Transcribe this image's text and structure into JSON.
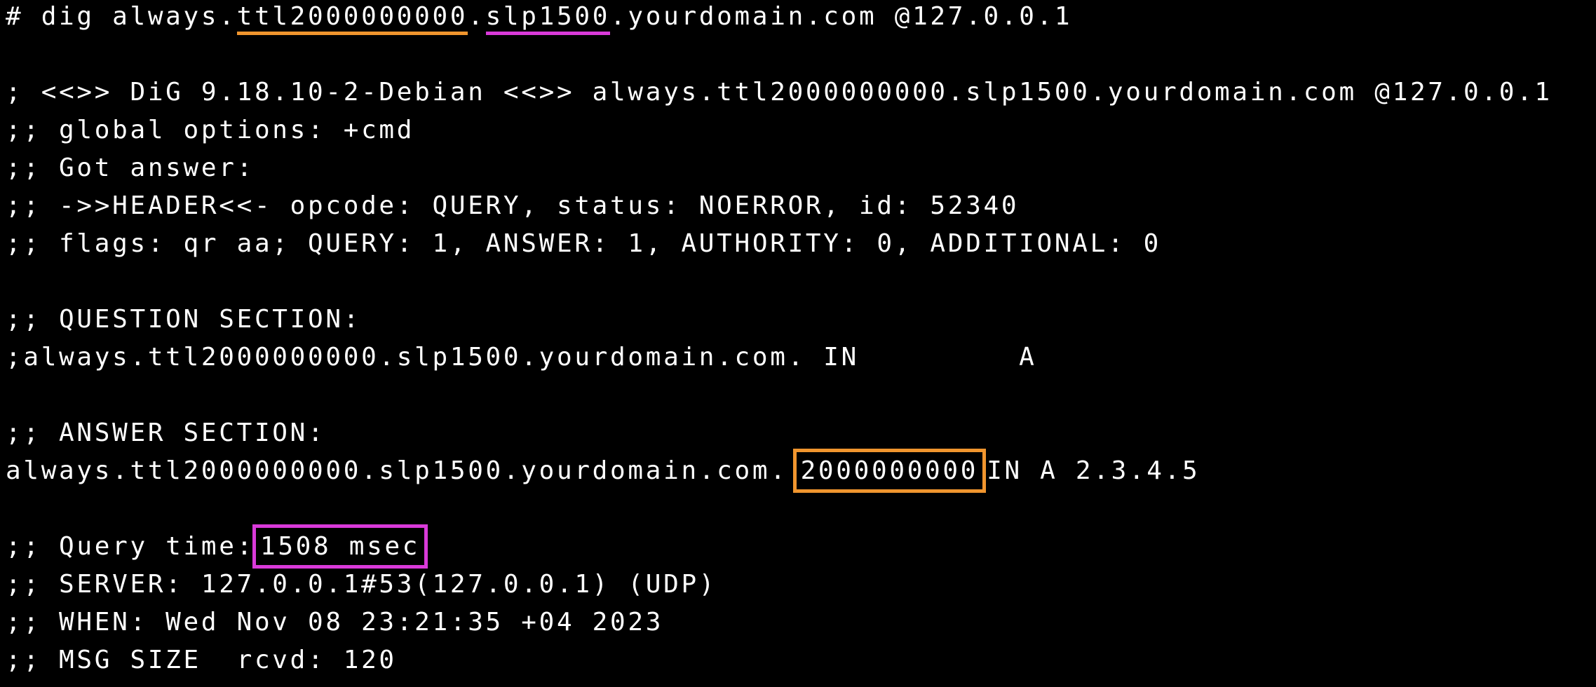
{
  "window": {
    "background": "#000000",
    "text_color": "#ffffff",
    "accent_orange": "#f0952e",
    "accent_magenta": "#d93ad9"
  },
  "command": {
    "prompt": "# dig always.",
    "ttl_label": "ttl2000000000",
    "dot": ".",
    "slp_label": "slp1500",
    "rest": ".yourdomain.com @127.0.0.1"
  },
  "output": {
    "banner": "; <<>> DiG 9.18.10-2-Debian <<>> always.ttl2000000000.slp1500.yourdomain.com @127.0.0.1",
    "global_options": ";; global options: +cmd",
    "got_answer": ";; Got answer:",
    "header": ";; ->>HEADER<<- opcode: QUERY, status: NOERROR, id: 52340",
    "flags": ";; flags: qr aa; QUERY: 1, ANSWER: 1, AUTHORITY: 0, ADDITIONAL: 0",
    "question_title": ";; QUESTION SECTION:",
    "question_record": ";always.ttl2000000000.slp1500.yourdomain.com. IN         A",
    "answer_title": ";; ANSWER SECTION:",
    "answer_name": "always.ttl2000000000.slp1500.yourdomain.com.",
    "answer_ttl": "2000000000",
    "answer_rest": "IN A 2.3.4.5",
    "query_time_label": ";; Query time:",
    "query_time_value": "1508 msec",
    "server": ";; SERVER: 127.0.0.1#53(127.0.0.1) (UDP)",
    "when": ";; WHEN: Wed Nov 08 23:21:35 +04 2023",
    "msg_size": ";; MSG SIZE  rcvd: 120"
  }
}
